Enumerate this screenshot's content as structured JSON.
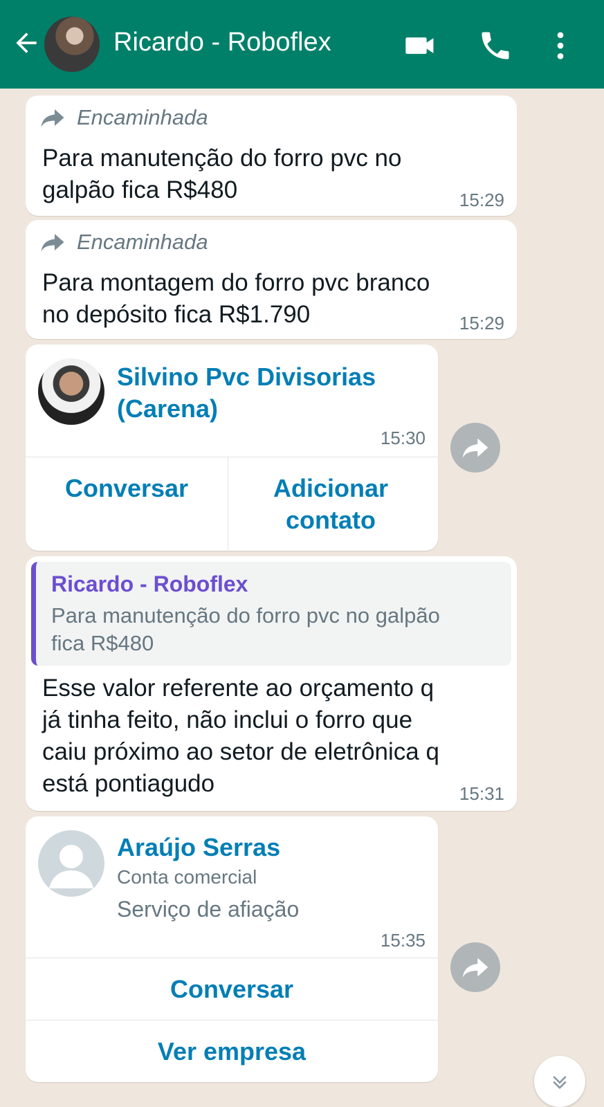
{
  "header": {
    "contact_name": "Ricardo - Roboflex",
    "icons": [
      "back-arrow-icon",
      "video-call-icon",
      "phone-icon",
      "more-options-icon"
    ],
    "color": "#008069"
  },
  "messages": [
    {
      "forwarded_label": "Encaminhada",
      "text_lines": [
        "Para manutenção do forro pvc no",
        "galpão fica R$480"
      ],
      "time": "15:29"
    },
    {
      "forwarded_label": "Encaminhada",
      "text_lines": [
        "Para montagem do forro pvc branco",
        "no depósito fica R$1.790"
      ],
      "time": "15:29"
    }
  ],
  "contact_card_1": {
    "name_lines": [
      "Silvino Pvc Divisorias",
      "(Carena)"
    ],
    "time": "15:30",
    "button_chat": "Conversar",
    "button_add_lines": [
      "Adicionar",
      "contato"
    ]
  },
  "reply_message": {
    "quoted_author": "Ricardo - Roboflex",
    "quoted_text_lines": [
      "Para manutenção do forro pvc no galpão",
      "fica R$480"
    ],
    "text_lines": [
      "Esse valor referente ao orçamento q",
      "já tinha feito, não inclui o forro que",
      "caiu próximo ao setor de eletrônica q",
      "está pontiagudo"
    ],
    "time": "15:31"
  },
  "contact_card_2": {
    "name": "Araújo Serras",
    "subtitle": "Conta comercial",
    "description": "Serviço de afiação",
    "time": "15:35",
    "button_chat": "Conversar",
    "button_business": "Ver empresa"
  },
  "colors": {
    "chat_background": "#efe7dd",
    "link_blue": "#027eb5",
    "quote_author": "#6b4fcf"
  }
}
